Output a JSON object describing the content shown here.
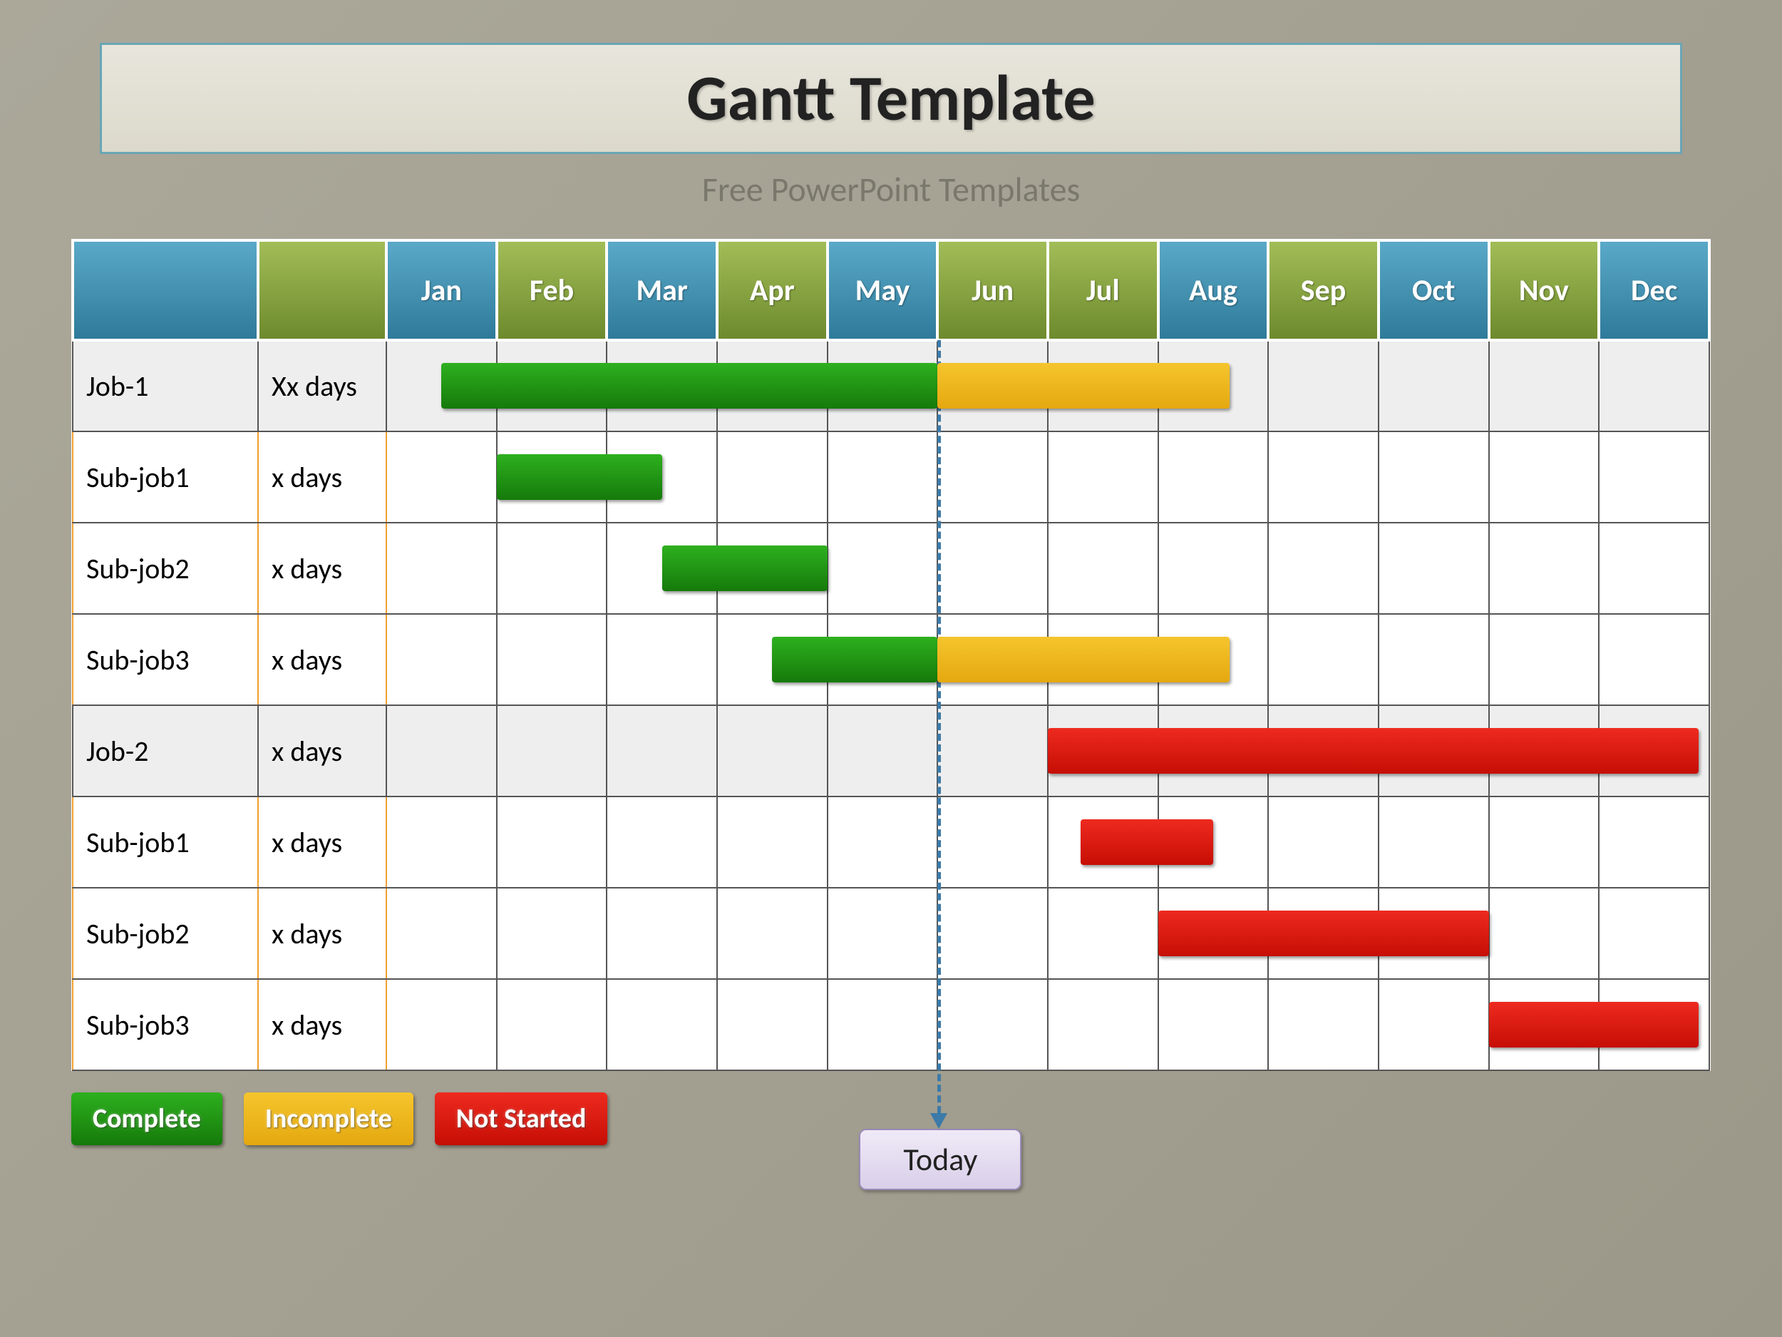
{
  "title": "Gantt Template",
  "subtitle": "Free PowerPoint Templates",
  "months": [
    "Jan",
    "Feb",
    "Mar",
    "Apr",
    "May",
    "Jun",
    "Jul",
    "Aug",
    "Sep",
    "Oct",
    "Nov",
    "Dec"
  ],
  "header_colors": [
    "blue",
    "green",
    "blue",
    "green",
    "blue",
    "green",
    "green",
    "blue",
    "green",
    "blue",
    "green",
    "blue"
  ],
  "rows": [
    {
      "name": "Job-1",
      "duration": "Xx days",
      "type": "job",
      "bars": [
        {
          "color": "green",
          "start": 1.5,
          "end": 6
        },
        {
          "color": "yellow",
          "start": 6,
          "end": 8.65
        }
      ]
    },
    {
      "name": "Sub-job1",
      "duration": "x days",
      "type": "sub",
      "bars": [
        {
          "color": "green",
          "start": 2,
          "end": 3.5
        }
      ]
    },
    {
      "name": "Sub-job2",
      "duration": "x days",
      "type": "sub",
      "bars": [
        {
          "color": "green",
          "start": 3.5,
          "end": 5
        }
      ]
    },
    {
      "name": "Sub-job3",
      "duration": "x days",
      "type": "sub",
      "bars": [
        {
          "color": "green",
          "start": 4.5,
          "end": 6
        },
        {
          "color": "yellow",
          "start": 6,
          "end": 8.65
        }
      ]
    },
    {
      "name": "Job-2",
      "duration": "x days",
      "type": "job",
      "bars": [
        {
          "color": "red",
          "start": 7,
          "end": 12.9
        }
      ]
    },
    {
      "name": "Sub-job1",
      "duration": "x days",
      "type": "sub",
      "bars": [
        {
          "color": "red",
          "start": 7.3,
          "end": 8.5
        }
      ]
    },
    {
      "name": "Sub-job2",
      "duration": "x days",
      "type": "sub",
      "bars": [
        {
          "color": "red",
          "start": 8,
          "end": 11
        }
      ]
    },
    {
      "name": "Sub-job3",
      "duration": "x days",
      "type": "sub",
      "bars": [
        {
          "color": "red",
          "start": 11,
          "end": 12.9
        }
      ]
    }
  ],
  "legend": {
    "complete": "Complete",
    "incomplete": "Incomplete",
    "not_started": "Not Started",
    "today": "Today"
  },
  "today_at": 6,
  "chart_data": {
    "type": "gantt",
    "title": "Gantt Template",
    "x_categories": [
      "Jan",
      "Feb",
      "Mar",
      "Apr",
      "May",
      "Jun",
      "Jul",
      "Aug",
      "Sep",
      "Oct",
      "Nov",
      "Dec"
    ],
    "today_marker": "Jun",
    "status_colors": {
      "Complete": "#1f9a12",
      "Incomplete": "#eab20f",
      "Not Started": "#d8140b"
    },
    "tasks": [
      {
        "task": "Job-1",
        "duration_label": "Xx days",
        "segments": [
          {
            "status": "Complete",
            "start": "mid-Jan",
            "end": "end-May"
          },
          {
            "status": "Incomplete",
            "start": "Jun",
            "end": "late-Aug"
          }
        ]
      },
      {
        "task": "Sub-job1",
        "parent": "Job-1",
        "duration_label": "x days",
        "segments": [
          {
            "status": "Complete",
            "start": "Feb",
            "end": "mid-Mar"
          }
        ]
      },
      {
        "task": "Sub-job2",
        "parent": "Job-1",
        "duration_label": "x days",
        "segments": [
          {
            "status": "Complete",
            "start": "mid-Mar",
            "end": "end-Apr"
          }
        ]
      },
      {
        "task": "Sub-job3",
        "parent": "Job-1",
        "duration_label": "x days",
        "segments": [
          {
            "status": "Complete",
            "start": "mid-Apr",
            "end": "end-May"
          },
          {
            "status": "Incomplete",
            "start": "Jun",
            "end": "late-Aug"
          }
        ]
      },
      {
        "task": "Job-2",
        "duration_label": "x days",
        "segments": [
          {
            "status": "Not Started",
            "start": "Jul",
            "end": "end-Dec"
          }
        ]
      },
      {
        "task": "Sub-job1",
        "parent": "Job-2",
        "duration_label": "x days",
        "segments": [
          {
            "status": "Not Started",
            "start": "early-Jul",
            "end": "mid-Aug"
          }
        ]
      },
      {
        "task": "Sub-job2",
        "parent": "Job-2",
        "duration_label": "x days",
        "segments": [
          {
            "status": "Not Started",
            "start": "Aug",
            "end": "end-Oct"
          }
        ]
      },
      {
        "task": "Sub-job3",
        "parent": "Job-2",
        "duration_label": "x days",
        "segments": [
          {
            "status": "Not Started",
            "start": "Nov",
            "end": "end-Dec"
          }
        ]
      }
    ]
  }
}
